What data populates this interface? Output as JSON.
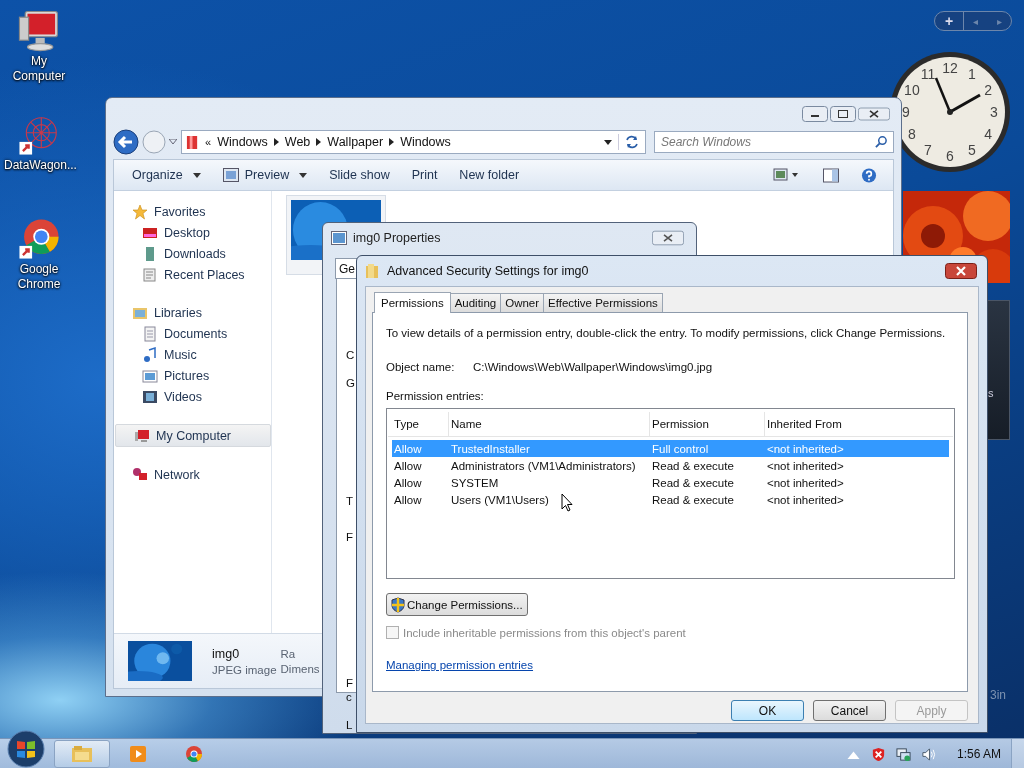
{
  "desktop_icons": [
    {
      "label": "My Computer",
      "kind": "computer"
    },
    {
      "label": "DataWagon...",
      "kind": "web"
    },
    {
      "label": "Google Chrome",
      "kind": "chrome"
    }
  ],
  "gadgets": {
    "toolbar": {
      "add": "+",
      "prev": "◂",
      "next": "▸"
    },
    "clock": {
      "numerals": [
        "12",
        "11",
        "1",
        "10",
        "2",
        "9",
        "3",
        "8",
        "4",
        "7",
        "5",
        "6"
      ]
    },
    "fragments": [
      "s",
      "3in"
    ]
  },
  "explorer": {
    "breadcrumb_overflow": "«",
    "breadcrumb": [
      "Windows",
      "Web",
      "Wallpaper",
      "Windows"
    ],
    "search": {
      "placeholder": "Search Windows"
    },
    "toolbar": [
      {
        "label": "Organize",
        "kind": "text",
        "dropdown": true
      },
      {
        "label": "Preview",
        "kind": "preview",
        "dropdown": true
      },
      {
        "label": "Slide show",
        "kind": "text",
        "dropdown": false
      },
      {
        "label": "Print",
        "kind": "text",
        "dropdown": false
      },
      {
        "label": "New folder",
        "kind": "text",
        "dropdown": false
      }
    ],
    "nav": [
      {
        "label": "Favorites",
        "kind": "star",
        "selected": false,
        "children": [
          {
            "label": "Desktop",
            "kind": "desktop",
            "selected": false
          },
          {
            "label": "Downloads",
            "kind": "downloads",
            "selected": false
          },
          {
            "label": "Recent Places",
            "kind": "recent",
            "selected": false
          }
        ]
      },
      {
        "label": "Libraries",
        "kind": "library",
        "selected": false,
        "children": [
          {
            "label": "Documents",
            "kind": "documents",
            "selected": false
          },
          {
            "label": "Music",
            "kind": "music",
            "selected": false
          },
          {
            "label": "Pictures",
            "kind": "pictures",
            "selected": false
          },
          {
            "label": "Videos",
            "kind": "videos",
            "selected": false
          }
        ]
      },
      {
        "label": "My Computer",
        "kind": "computer",
        "selected": true
      },
      {
        "label": "Network",
        "kind": "network",
        "selected": false
      }
    ],
    "details": {
      "name": "img0",
      "type": "JPEG image",
      "column_3": "Ra",
      "column_4": "Dimens"
    }
  },
  "properties": {
    "title": "img0 Properties",
    "tab": "Ge",
    "fragments": [
      "C",
      "G",
      "T",
      "F",
      "F",
      "c",
      "L"
    ]
  },
  "security": {
    "title": "Advanced Security Settings for img0",
    "tabs": [
      {
        "label": "Permissions",
        "selected": true
      },
      {
        "label": "Auditing",
        "selected": false
      },
      {
        "label": "Owner",
        "selected": false
      },
      {
        "label": "Effective Permissions",
        "selected": false
      }
    ],
    "intro": "To view details of a permission entry, double-click the entry. To modify permissions, click Change Permissions.",
    "object_label": "Object name:",
    "object_value": "C:\\Windows\\Web\\Wallpaper\\Windows\\img0.jpg",
    "entries_label": "Permission entries:",
    "columns": [
      "Type",
      "Name",
      "Permission",
      "Inherited From"
    ],
    "rows": [
      {
        "type": "Allow",
        "name": "TrustedInstaller",
        "permission": "Full control",
        "inherited": "<not inherited>",
        "selected": true
      },
      {
        "type": "Allow",
        "name": "Administrators (VM1\\Administrators)",
        "permission": "Read & execute",
        "inherited": "<not inherited>",
        "selected": false
      },
      {
        "type": "Allow",
        "name": "SYSTEM",
        "permission": "Read & execute",
        "inherited": "<not inherited>",
        "selected": false
      },
      {
        "type": "Allow",
        "name": "Users (VM1\\Users)",
        "permission": "Read & execute",
        "inherited": "<not inherited>",
        "selected": false
      }
    ],
    "change_button": "Change Permissions...",
    "inherit_checkbox": {
      "label": "Include inheritable permissions from this object's parent",
      "checked": false,
      "disabled": true
    },
    "link": "Managing permission entries",
    "buttons": [
      {
        "label": "OK",
        "kind": "default",
        "disabled": false
      },
      {
        "label": "Cancel",
        "kind": "normal",
        "disabled": false
      },
      {
        "label": "Apply",
        "kind": "normal",
        "disabled": true
      }
    ]
  },
  "taskbar": {
    "items": [
      {
        "kind": "explorer",
        "active": true
      },
      {
        "kind": "media",
        "active": false
      },
      {
        "kind": "chrome",
        "active": false
      }
    ],
    "time": "1:56 AM"
  }
}
